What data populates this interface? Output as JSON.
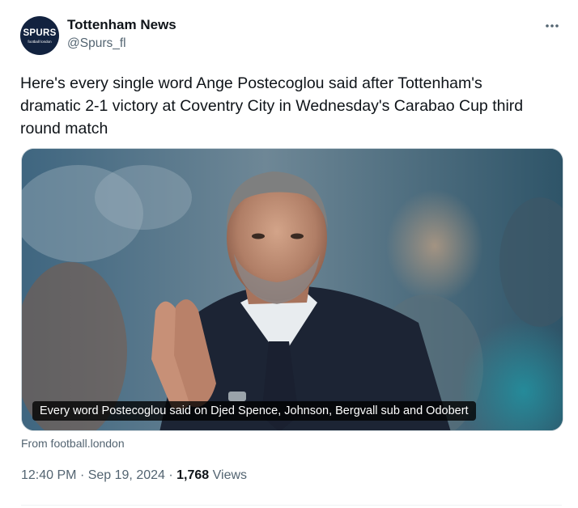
{
  "author": {
    "name": "Tottenham News",
    "handle": "@Spurs_fl",
    "avatar_text": "SPURS",
    "avatar_subtext": "football london"
  },
  "tweet": {
    "text": "Here's every single word Ange Postecoglou said after Tottenham's\ndramatic 2-1 victory at Coventry City in Wednesday's Carabao Cup third\nround match",
    "media_caption": "Every word Postecoglou said on Djed Spence, Johnson, Bergvall sub and Odobert",
    "source": "From football.london",
    "time": "12:40 PM",
    "separator": "·",
    "date": "Sep 19, 2024",
    "views_count": "1,768",
    "views_label": "Views"
  },
  "icons": {
    "more": "more-horizontal-icon"
  },
  "colors": {
    "text_primary": "#0f1419",
    "text_secondary": "#536471",
    "avatar_bg": "#12223f",
    "border": "#cfd9de"
  }
}
